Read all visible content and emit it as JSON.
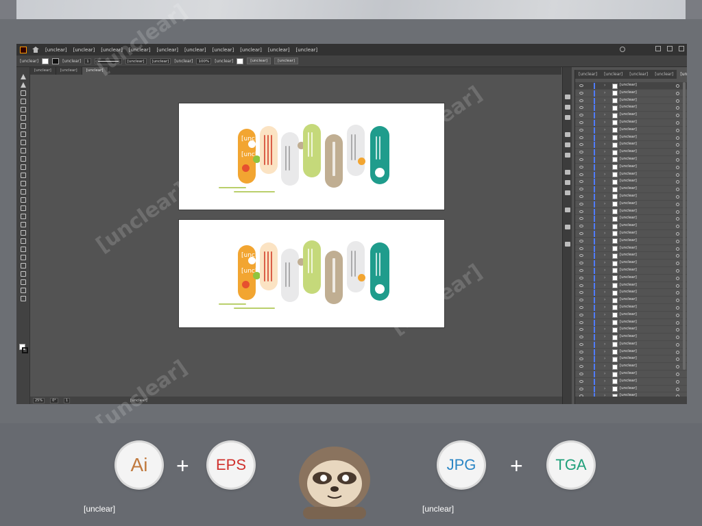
{
  "app": {
    "menu": [
      "[unclear]",
      "[unclear]",
      "[unclear]",
      "[unclear]",
      "[unclear]",
      "[unclear]",
      "[unclear]",
      "[unclear]",
      "[unclear]",
      "[unclear]"
    ],
    "control": {
      "stroke_label": "[unclear]",
      "stroke_value": "1",
      "profile": "[unclear]",
      "brush": "[unclear]",
      "opacity_label": "[unclear]",
      "opacity_value": "100%",
      "style_label": "[unclear]",
      "doc_setup": "[unclear]",
      "prefs": "[unclear]"
    },
    "tabs": [
      "[unclear]",
      "[unclear]",
      "[unclear]"
    ],
    "status": {
      "zoom": "25%",
      "rotate": "0°",
      "artboard": "1",
      "mode": "[unclear]"
    },
    "layers_panel": {
      "tabs": [
        "[unclear]",
        "[unclear]",
        "[unclear]",
        "[unclear]",
        "[unclear]"
      ],
      "rows": [
        "[unclear]",
        "[unclear]",
        "[unclear]",
        "[unclear]",
        "[unclear]",
        "[unclear]",
        "[unclear]",
        "[unclear]",
        "[unclear]",
        "[unclear]",
        "[unclear]",
        "[unclear]",
        "[unclear]",
        "[unclear]",
        "[unclear]",
        "[unclear]",
        "[unclear]",
        "[unclear]",
        "[unclear]",
        "[unclear]",
        "[unclear]",
        "[unclear]",
        "[unclear]",
        "[unclear]",
        "[unclear]",
        "[unclear]",
        "[unclear]",
        "[unclear]",
        "[unclear]",
        "[unclear]",
        "[unclear]",
        "[unclear]",
        "[unclear]",
        "[unclear]",
        "[unclear]",
        "[unclear]",
        "[unclear]",
        "[unclear]",
        "[unclear]",
        "[unclear]",
        "[unclear]",
        "[unclear]",
        "[unclear]"
      ]
    }
  },
  "artwork": {
    "title_chars": [
      "[unclear]",
      "[unclear]"
    ],
    "colors": {
      "orange": "#f2a531",
      "cream": "#fbe3c3",
      "gray": "#e9e9ea",
      "green": "#c5d97a",
      "tan": "#c0ae92",
      "teal": "#1f9c8c"
    }
  },
  "promo": {
    "formats": [
      "Ai",
      "EPS",
      "JPG",
      "TGA"
    ],
    "left_caption": "[unclear]",
    "right_caption": "[unclear]"
  }
}
